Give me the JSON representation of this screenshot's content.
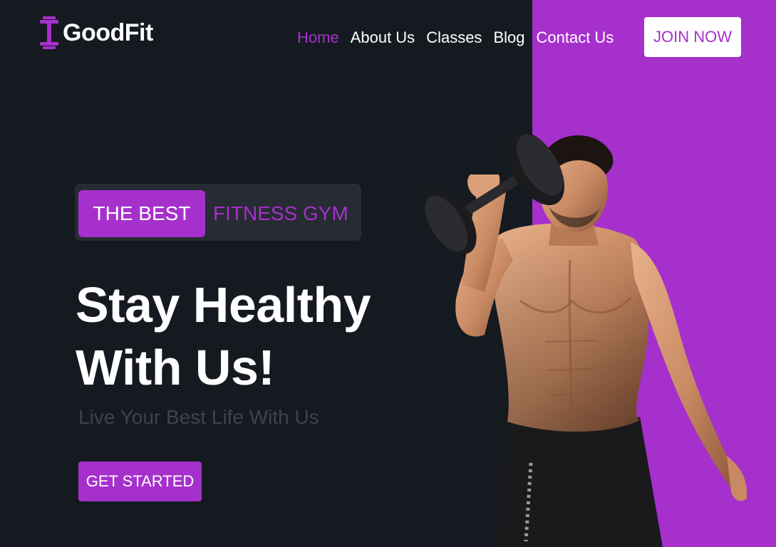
{
  "brand": {
    "name": "GoodFit",
    "icon": "dumbbell-icon"
  },
  "nav": {
    "items": [
      {
        "label": "Home",
        "active": true
      },
      {
        "label": "About Us",
        "active": false
      },
      {
        "label": "Classes",
        "active": false
      },
      {
        "label": "Blog",
        "active": false
      },
      {
        "label": "Contact Us",
        "active": false
      }
    ],
    "cta_label": "JOIN NOW"
  },
  "hero": {
    "badge_highlight": "THE BEST",
    "badge_rest": "FITNESS GYM",
    "headline_line1": "Stay Healthy",
    "headline_line2": "With Us!",
    "subheadline": "Live Your Best Life With Us",
    "cta_label": "GET STARTED",
    "image_description": "muscular-man-with-dumbbell"
  },
  "colors": {
    "background": "#151a21",
    "accent": "#a630cc",
    "badge_bg": "#272b33",
    "muted_text": "#3d4350",
    "white": "#ffffff"
  }
}
